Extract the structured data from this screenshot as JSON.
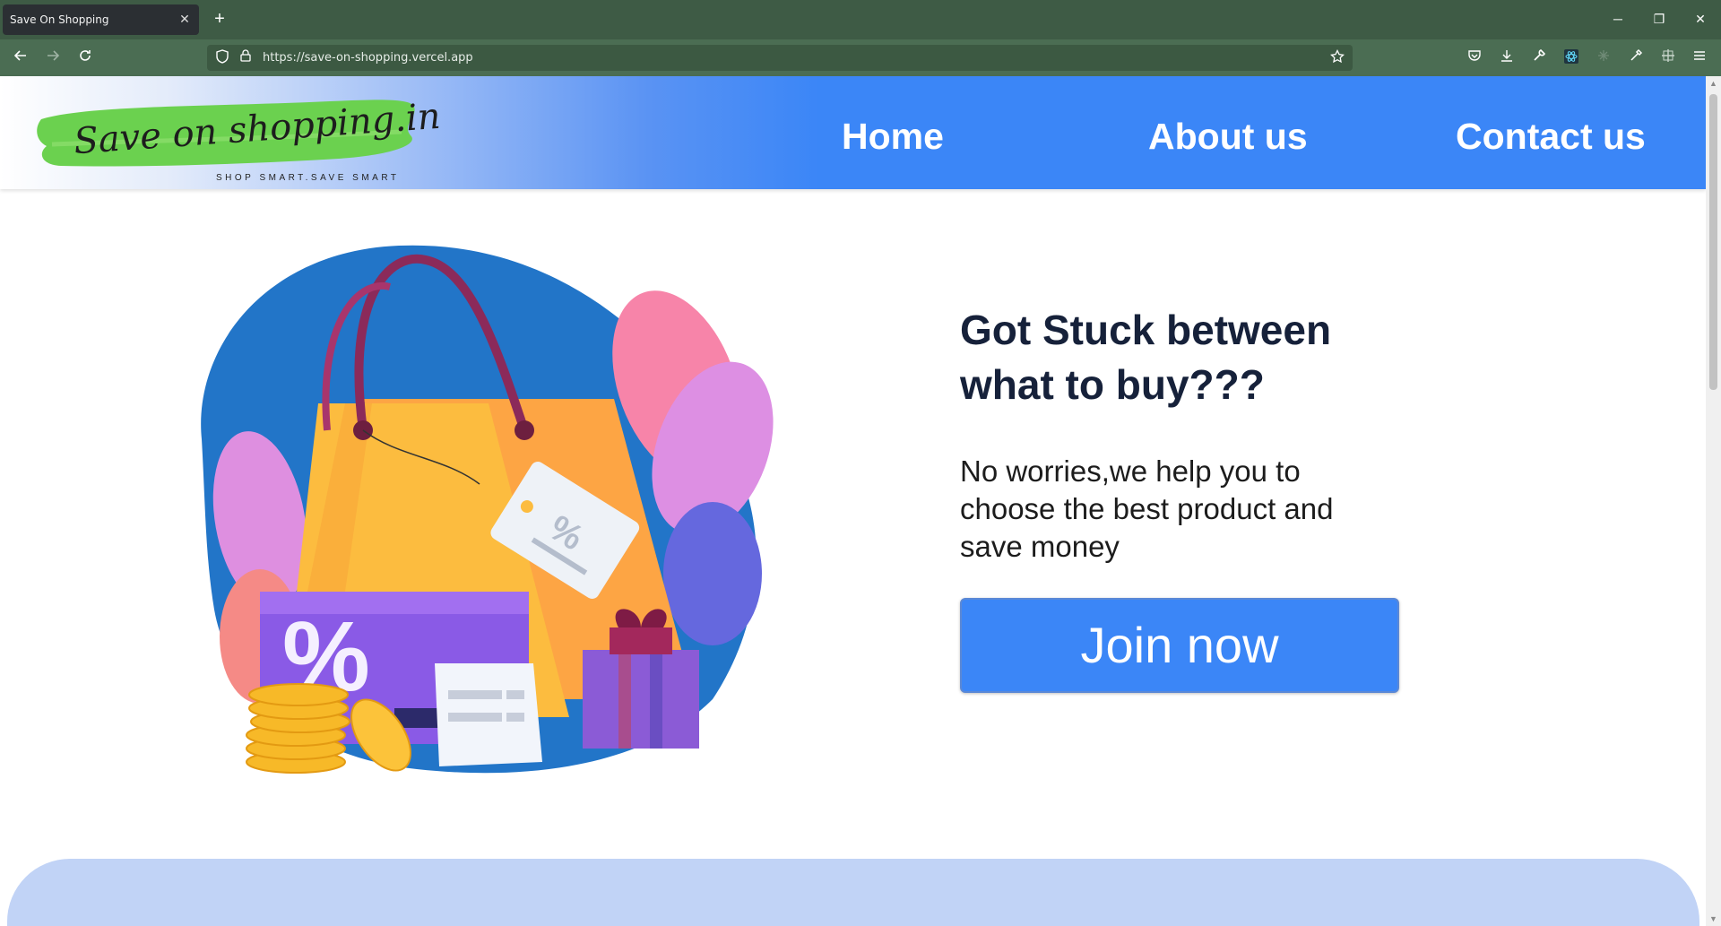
{
  "browser": {
    "tab_title": "Save On Shopping",
    "tab_close": "✕",
    "new_tab": "+",
    "url": "https://save-on-shopping.vercel.app",
    "controls": {
      "minimize": "─",
      "restore": "❐",
      "close": "✕"
    }
  },
  "site": {
    "logo_text": "Save on shopping.in",
    "logo_tagline": "SHOP SMART.SAVE SMART",
    "menu": [
      {
        "label": "Home"
      },
      {
        "label": "About us"
      },
      {
        "label": "Contact us"
      }
    ],
    "hero": {
      "title": "Got Stuck between what to buy???",
      "subtitle": "No worries,we help you to choose the best product and save money",
      "cta": "Join now"
    },
    "colors": {
      "accent": "#3b86f7",
      "next_section": "#c1d3f6",
      "title": "#16213a"
    }
  }
}
